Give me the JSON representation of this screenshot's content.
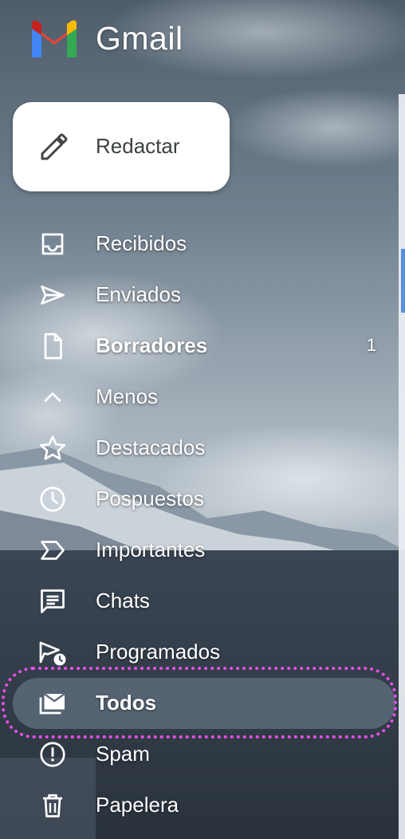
{
  "header": {
    "app_title": "Gmail",
    "logo_icon": "gmail-logo-icon",
    "logo_colors": [
      "#4285F4",
      "#EA4335",
      "#FBBC04",
      "#34A853",
      "#C5221F"
    ]
  },
  "compose": {
    "label": "Redactar",
    "icon": "pencil-icon"
  },
  "nav": {
    "items": [
      {
        "label": "Recibidos",
        "icon": "inbox-icon",
        "bold": false,
        "active": false
      },
      {
        "label": "Enviados",
        "icon": "send-icon",
        "bold": false,
        "active": false
      },
      {
        "label": "Borradores",
        "icon": "draft-file-icon",
        "bold": true,
        "active": false,
        "count": "1"
      },
      {
        "label": "Menos",
        "icon": "chevron-up-icon",
        "bold": false,
        "active": false
      },
      {
        "label": "Destacados",
        "icon": "star-icon",
        "bold": false,
        "active": false
      },
      {
        "label": "Pospuestos",
        "icon": "clock-icon",
        "bold": false,
        "active": false
      },
      {
        "label": "Importantes",
        "icon": "label-important-icon",
        "bold": false,
        "active": false
      },
      {
        "label": "Chats",
        "icon": "chat-icon",
        "bold": false,
        "active": false
      },
      {
        "label": "Programados",
        "icon": "scheduled-send-icon",
        "bold": false,
        "active": false
      },
      {
        "label": "Todos",
        "icon": "all-mail-icon",
        "bold": true,
        "active": true
      },
      {
        "label": "Spam",
        "icon": "spam-icon",
        "bold": false,
        "active": false
      },
      {
        "label": "Papelera",
        "icon": "trash-icon",
        "bold": false,
        "active": false
      }
    ]
  },
  "colors": {
    "text": "#ffffff",
    "compose_bg": "#ffffff",
    "compose_text": "#3c4043",
    "active_bg": "#5f6e7d",
    "highlight_marker": "#e84fe8",
    "edge_accent": "#5a8fe0"
  }
}
